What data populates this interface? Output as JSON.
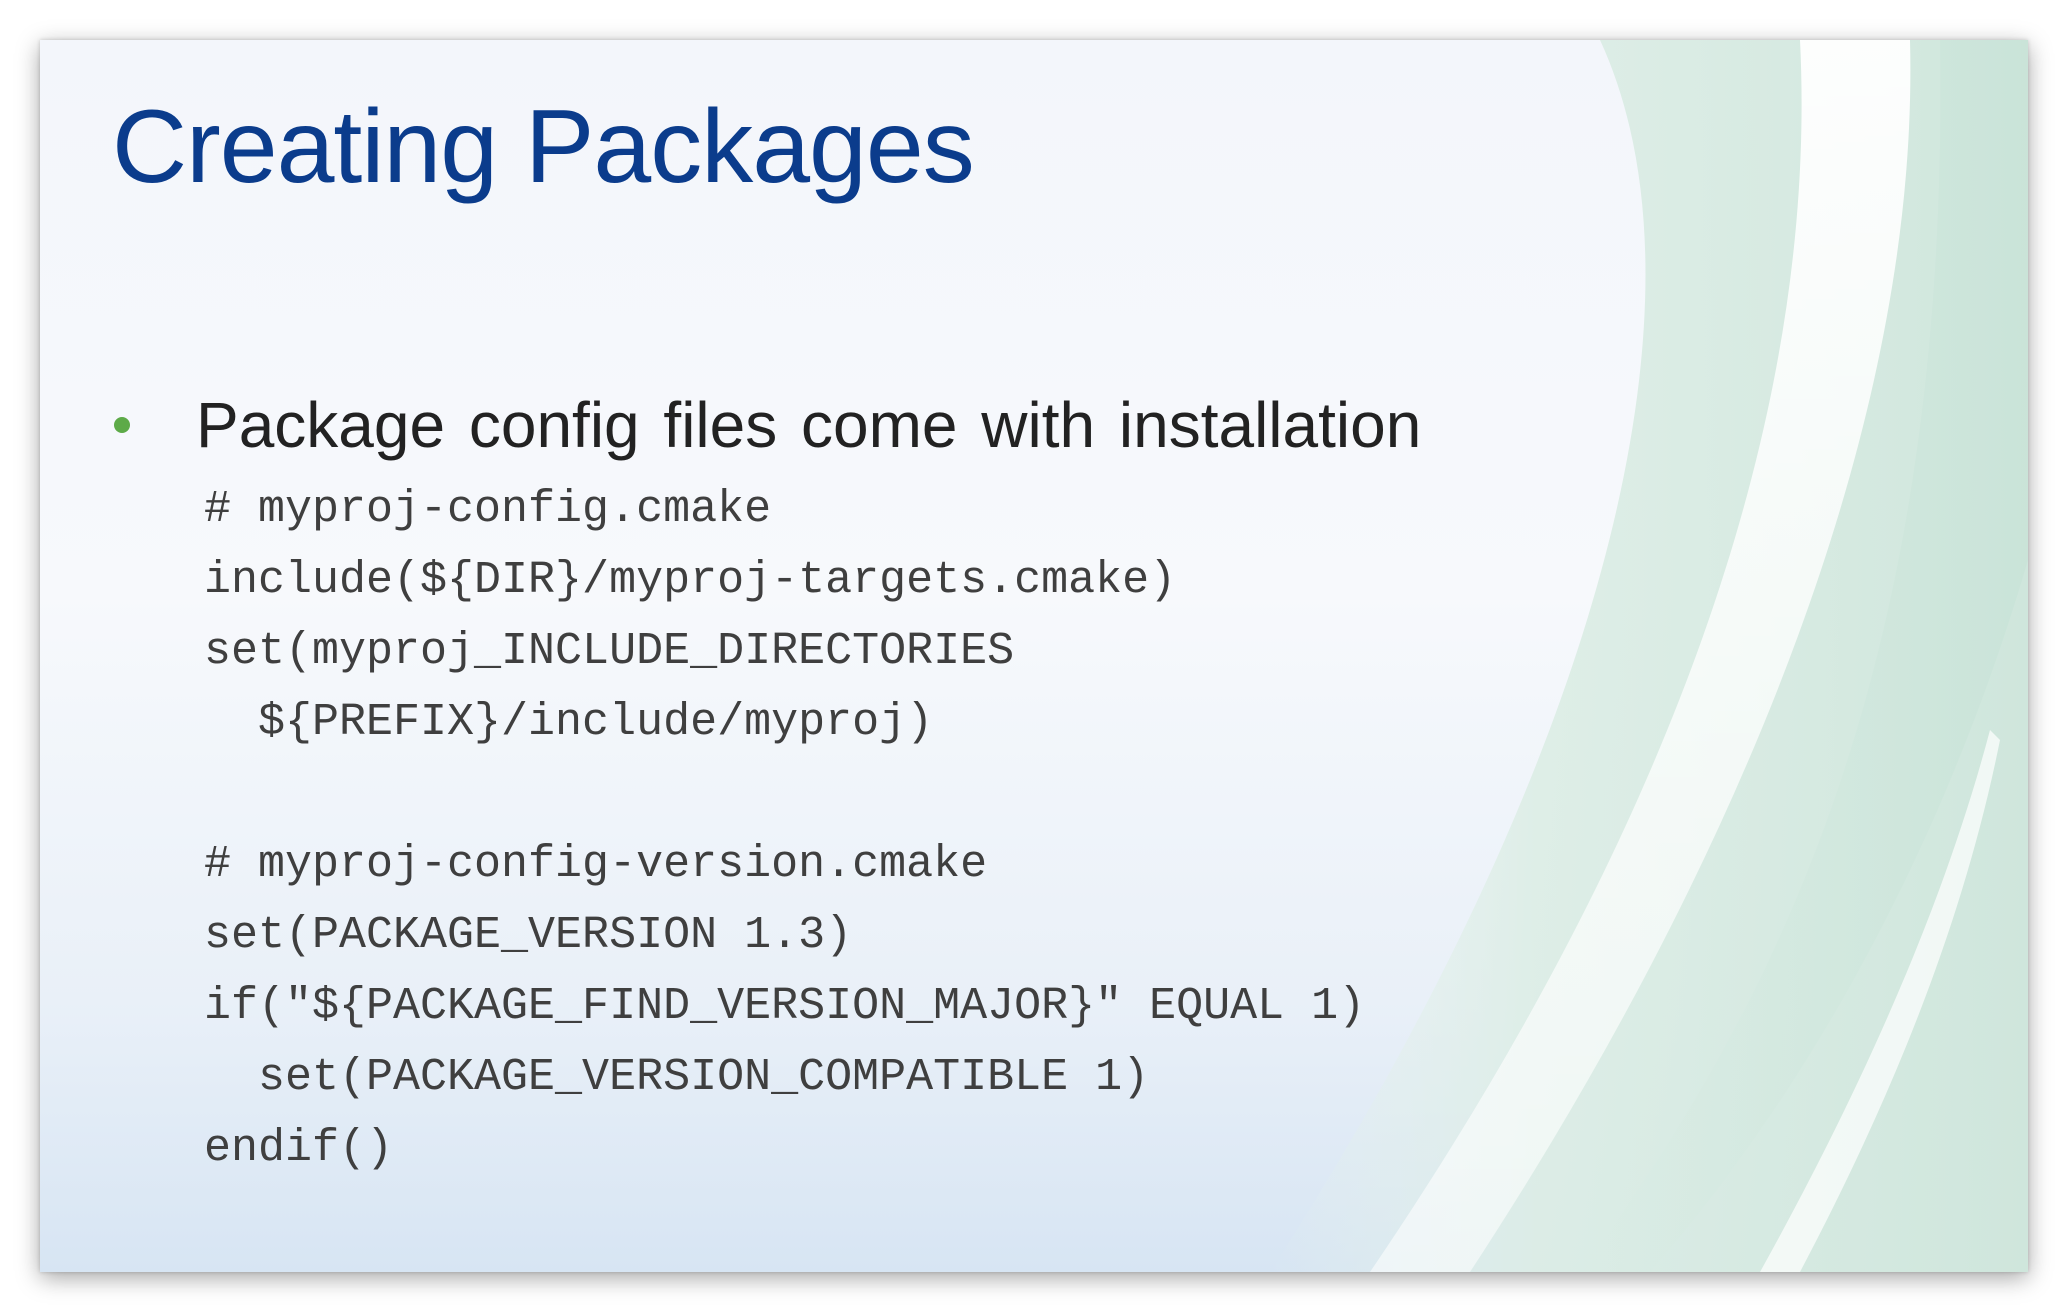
{
  "slide": {
    "title": "Creating Packages",
    "bullet": "Package config files come with installation",
    "code_lines": [
      "# myproj-config.cmake",
      "include(${DIR}/myproj-targets.cmake)",
      "set(myproj_INCLUDE_DIRECTORIES",
      "  ${PREFIX}/include/myproj)",
      "",
      "# myproj-config-version.cmake",
      "set(PACKAGE_VERSION 1.3)",
      "if(\"${PACKAGE_FIND_VERSION_MAJOR}\" EQUAL 1)",
      "  set(PACKAGE_VERSION_COMPATIBLE 1)",
      "endif()"
    ]
  },
  "colors": {
    "title": "#0b3c8c",
    "bullet_dot": "#5daa48",
    "body_text": "#222222",
    "code_text": "#3f3f3f",
    "decor_green": "#cfe6dc"
  }
}
